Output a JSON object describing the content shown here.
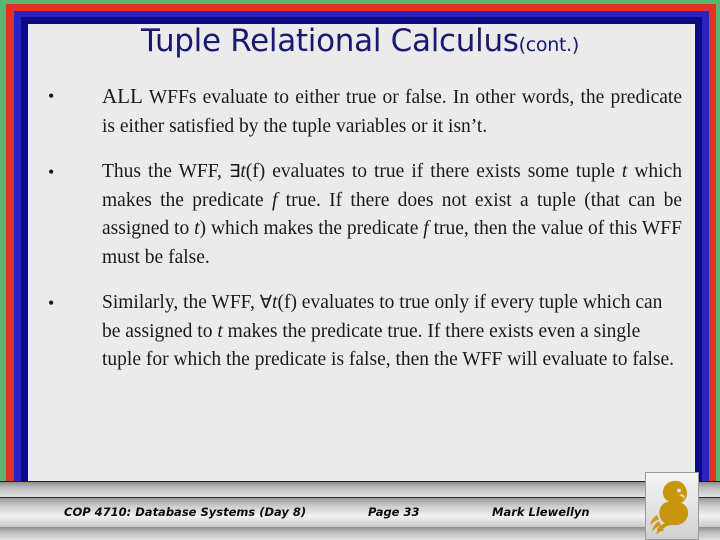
{
  "slide": {
    "title_main": "Tuple Relational Calculus",
    "title_suffix": "(cont.)",
    "title_color": "#191970",
    "background_color": "#ebebeb"
  },
  "borders": {
    "green": "#5bb572",
    "red": "#e03123",
    "blue": "#2a22c4",
    "navy": "#0d0b83"
  },
  "bullets": [
    {
      "marker": "•",
      "segments": [
        {
          "text": "ALL",
          "style": "smallcap"
        },
        {
          "text": " WFFs evaluate to either true or false.  In other words, the predicate is either satisfied by the tuple variables or it isn’t.",
          "style": "normal"
        }
      ],
      "plain": "ALL WFFs evaluate to either true or false.  In other words, the predicate is either satisfied by the tuple variables or it isn’t."
    },
    {
      "marker": "•",
      "segments": [
        {
          "text": "Thus the WFF, ",
          "style": "normal"
        },
        {
          "text": "∃",
          "style": "quantifier"
        },
        {
          "text": "t",
          "style": "italic"
        },
        {
          "text": "(f)  evaluates to true if there exists some tuple ",
          "style": "normal"
        },
        {
          "text": "t",
          "style": "italic"
        },
        {
          "text": " which makes the predicate ",
          "style": "normal"
        },
        {
          "text": "f",
          "style": "italic"
        },
        {
          "text": " true.  If there does not exist a tuple (that can be assigned to ",
          "style": "normal"
        },
        {
          "text": "t",
          "style": "italic"
        },
        {
          "text": ") which makes the predicate ",
          "style": "normal"
        },
        {
          "text": "f",
          "style": "italic"
        },
        {
          "text": " true, then the value of this WFF must be false.",
          "style": "normal"
        }
      ],
      "plain": "Thus the WFF, ∃t(f)  evaluates to true if there exists some tuple t which makes the predicate f true.  If there does not exist a tuple (that can be assigned to t) which makes the predicate f true, then the value of this WFF must be false."
    },
    {
      "marker": "•",
      "segments": [
        {
          "text": "Similarly, the WFF, ",
          "style": "normal"
        },
        {
          "text": "∀",
          "style": "quantifier"
        },
        {
          "text": "t",
          "style": "italic"
        },
        {
          "text": "(f) evaluates to true only if every tuple which can be assigned to ",
          "style": "normal"
        },
        {
          "text": "t",
          "style": "italic"
        },
        {
          "text": " makes the predicate true. If there exists even a single tuple for which the predicate is false, then the WFF will evaluate to false.",
          "style": "normal"
        }
      ],
      "plain": "Similarly, the WFF, ∀t(f) evaluates to true only if every tuple which can be assigned to t makes the predicate true. If there exists even a single tuple for which the predicate is false, then the WFF will evaluate to false."
    }
  ],
  "footer": {
    "course": "COP 4710: Database Systems  (Day 8)",
    "page": "Page 33",
    "author": "Mark Llewellyn",
    "logo_name": "ucf-pegasus-logo",
    "logo_color": "#c8960c"
  }
}
